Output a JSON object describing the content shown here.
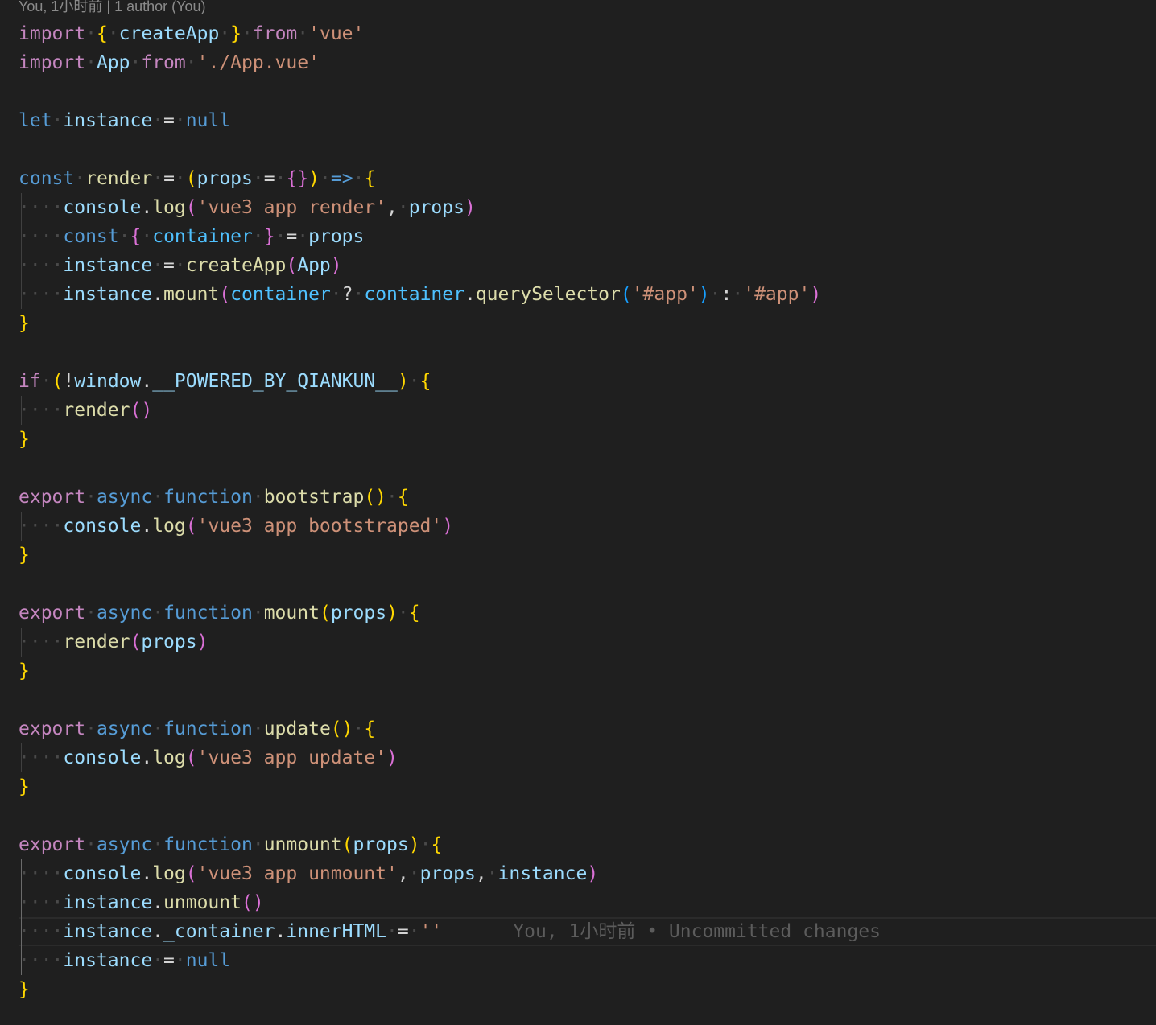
{
  "codelens": {
    "text": "You, 1小时前 | 1 author (You)"
  },
  "blame": {
    "text": "You, 1小时前 • Uncommitted changes"
  },
  "code": {
    "l1": {
      "import": "import",
      "lb": "{",
      "createApp": "createApp",
      "rb": "}",
      "from": "from",
      "str": "'vue'"
    },
    "l2": {
      "import": "import",
      "app": "App",
      "from": "from",
      "str": "'./App.vue'"
    },
    "l4": {
      "let": "let",
      "instance": "instance",
      "eq": "=",
      "null": "null"
    },
    "l6": {
      "const": "const",
      "render": "render",
      "eq": "=",
      "lp": "(",
      "props": "props",
      "eq2": "=",
      "obj": "{}",
      "rp": ")",
      "arrow": "=>",
      "lb": "{"
    },
    "l7": {
      "console": "console",
      "dot": ".",
      "log": "log",
      "lp": "(",
      "str": "'vue3 app render'",
      "comma": ",",
      "props": "props",
      "rp": ")"
    },
    "l8": {
      "const": "const",
      "lb": "{",
      "container": "container",
      "rb": "}",
      "eq": "=",
      "props": "props"
    },
    "l9": {
      "instance": "instance",
      "eq": "=",
      "createApp": "createApp",
      "lp": "(",
      "app": "App",
      "rp": ")"
    },
    "l10": {
      "instance": "instance",
      "dot": ".",
      "mount": "mount",
      "lp": "(",
      "container": "container",
      "q": "?",
      "container2": "container",
      "dot2": ".",
      "qs": "querySelector",
      "lp2": "(",
      "str": "'#app'",
      "rp2": ")",
      "colon": ":",
      "str2": "'#app'",
      "rp": ")"
    },
    "l11": {
      "rb": "}"
    },
    "l13": {
      "if": "if",
      "lp": "(",
      "not": "!",
      "window": "window",
      "dot": ".",
      "qiankun": "__POWERED_BY_QIANKUN__",
      "rp": ")",
      "lb": "{"
    },
    "l14": {
      "render": "render",
      "parens": "()"
    },
    "l15": {
      "rb": "}"
    },
    "l17": {
      "export": "export",
      "async": "async",
      "function": "function",
      "name": "bootstrap",
      "parens": "()",
      "lb": "{"
    },
    "l18": {
      "console": "console",
      "dot": ".",
      "log": "log",
      "lp": "(",
      "str": "'vue3 app bootstraped'",
      "rp": ")"
    },
    "l19": {
      "rb": "}"
    },
    "l21": {
      "export": "export",
      "async": "async",
      "function": "function",
      "name": "mount",
      "lp": "(",
      "props": "props",
      "rp": ")",
      "lb": "{"
    },
    "l22": {
      "render": "render",
      "lp": "(",
      "props": "props",
      "rp": ")"
    },
    "l23": {
      "rb": "}"
    },
    "l25": {
      "export": "export",
      "async": "async",
      "function": "function",
      "name": "update",
      "parens": "()",
      "lb": "{"
    },
    "l26": {
      "console": "console",
      "dot": ".",
      "log": "log",
      "lp": "(",
      "str": "'vue3 app update'",
      "rp": ")"
    },
    "l27": {
      "rb": "}"
    },
    "l29": {
      "export": "export",
      "async": "async",
      "function": "function",
      "name": "unmount",
      "lp": "(",
      "props": "props",
      "rp": ")",
      "lb": "{"
    },
    "l30": {
      "console": "console",
      "dot": ".",
      "log": "log",
      "lp": "(",
      "str": "'vue3 app unmount'",
      "comma": ",",
      "props": "props",
      "comma2": ",",
      "instance": "instance",
      "rp": ")"
    },
    "l31": {
      "instance": "instance",
      "dot": ".",
      "unmount": "unmount",
      "parens": "()"
    },
    "l32": {
      "instance": "instance",
      "dot": ".",
      "container": "_container",
      "dot2": ".",
      "inner": "innerHTML",
      "eq": "=",
      "str": "''"
    },
    "l33": {
      "instance": "instance",
      "eq": "=",
      "null": "null"
    },
    "l34": {
      "rb": "}"
    }
  }
}
